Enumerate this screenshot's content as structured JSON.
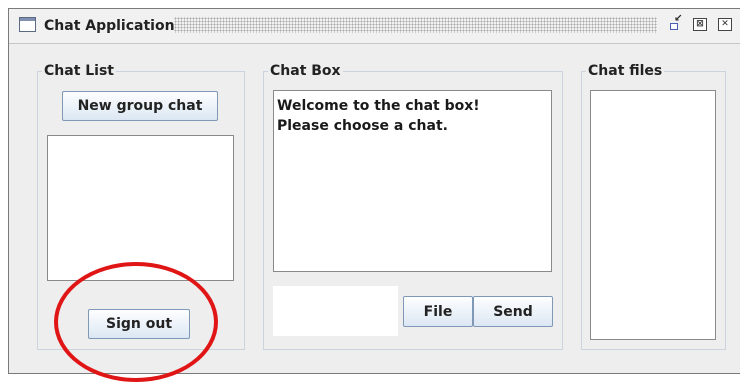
{
  "window": {
    "title": "Chat Application",
    "controls": {
      "iconify_icon": "iconify-icon",
      "maximize_glyph": "⊠",
      "close_glyph": "✕"
    }
  },
  "chat_list": {
    "title": "Chat List",
    "new_group_label": "New group chat",
    "items": [],
    "sign_out_label": "Sign out"
  },
  "chat_box": {
    "title": "Chat Box",
    "lines": [
      "Welcome to the chat box!",
      "Please choose a chat."
    ],
    "message_value": "",
    "file_label": "File",
    "send_label": "Send"
  },
  "chat_files": {
    "title": "Chat files",
    "items": []
  },
  "colors": {
    "annotation": "#e01616",
    "button_border": "#7e98b6"
  }
}
